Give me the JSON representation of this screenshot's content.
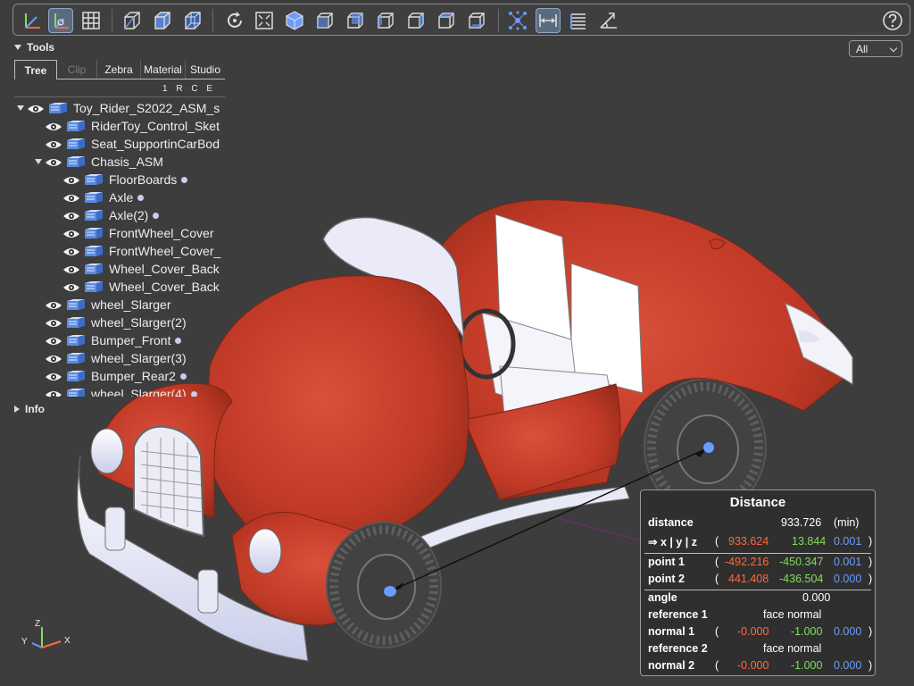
{
  "toolbar": {
    "icons": [
      "axes-icon",
      "origin-axes-icon",
      "grid-icon",
      "box-outline-icon",
      "box-solid-icon",
      "box-wire-icon",
      "rotate-icon",
      "fit-view-icon",
      "iso-view-icon",
      "front-view-icon",
      "back-view-icon",
      "left-view-icon",
      "right-view-icon",
      "top-view-icon",
      "bottom-view-icon",
      "explode-icon",
      "measure-icon",
      "list-icon",
      "angle-icon",
      "help-icon"
    ],
    "active": "measure-icon"
  },
  "tools": {
    "header": "Tools",
    "filter": "All",
    "tabs": [
      {
        "label": "Tree",
        "state": "active"
      },
      {
        "label": "Clip",
        "state": "disabled"
      },
      {
        "label": "Zebra",
        "state": "normal"
      },
      {
        "label": "Material",
        "state": "normal"
      },
      {
        "label": "Studio",
        "state": "normal"
      }
    ],
    "columns": "1 R C E",
    "tree": [
      {
        "label": "Toy_Rider_S2022_ASM_s",
        "level": 0,
        "expander": "open",
        "dot": false
      },
      {
        "label": "RiderToy_Control_Sket",
        "level": 1,
        "expander": "none",
        "dot": false
      },
      {
        "label": "Seat_SupportinCarBod",
        "level": 1,
        "expander": "none",
        "dot": false
      },
      {
        "label": "Chasis_ASM",
        "level": 1,
        "expander": "open",
        "dot": false
      },
      {
        "label": "FloorBoards",
        "level": 2,
        "expander": "none",
        "dot": true
      },
      {
        "label": "Axle",
        "level": 2,
        "expander": "none",
        "dot": true
      },
      {
        "label": "Axle(2)",
        "level": 2,
        "expander": "none",
        "dot": true
      },
      {
        "label": "FrontWheel_Cover",
        "level": 2,
        "expander": "none",
        "dot": false
      },
      {
        "label": "FrontWheel_Cover_",
        "level": 2,
        "expander": "none",
        "dot": false
      },
      {
        "label": "Wheel_Cover_Back",
        "level": 2,
        "expander": "none",
        "dot": false
      },
      {
        "label": "Wheel_Cover_Back",
        "level": 2,
        "expander": "none",
        "dot": false
      },
      {
        "label": "wheel_Slarger",
        "level": 1,
        "expander": "none",
        "dot": false
      },
      {
        "label": "wheel_Slarger(2)",
        "level": 1,
        "expander": "none",
        "dot": false
      },
      {
        "label": "Bumper_Front",
        "level": 1,
        "expander": "none",
        "dot": true
      },
      {
        "label": "wheel_Slarger(3)",
        "level": 1,
        "expander": "none",
        "dot": false
      },
      {
        "label": "Bumper_Rear2",
        "level": 1,
        "expander": "none",
        "dot": true
      },
      {
        "label": "wheel_Slarger(4)",
        "level": 1,
        "expander": "none",
        "dot": true
      }
    ]
  },
  "info": {
    "header": "Info"
  },
  "distance": {
    "title": "Distance",
    "distance_label": "distance",
    "distance_value": "933.726",
    "distance_mode": "(min)",
    "xyz_label": "⇒ x | y | z",
    "dx": "933.624",
    "dy": "13.844",
    "dz": "0.001",
    "point1_label": "point 1",
    "p1x": "-492.216",
    "p1y": "-450.347",
    "p1z": "0.001",
    "point2_label": "point 2",
    "p2x": "441.408",
    "p2y": "-436.504",
    "p2z": "0.000",
    "angle_label": "angle",
    "angle_value": "0.000",
    "ref1_label": "reference 1",
    "ref1_value": "face normal",
    "normal1_label": "normal 1",
    "n1x": "-0.000",
    "n1y": "-1.000",
    "n1z": "0.000",
    "ref2_label": "reference 2",
    "ref2_value": "face normal",
    "normal2_label": "normal 2",
    "n2x": "-0.000",
    "n2y": "-1.000",
    "n2z": "0.000",
    "open_paren": "(",
    "close_paren": ")"
  },
  "triad": {
    "x": "X",
    "y": "Y",
    "z": "Z"
  },
  "colors": {
    "body": "#c53a28",
    "accent": "#6a9cff",
    "x": "#ff6a3d",
    "y": "#7ee05a",
    "z": "#6a9cff"
  }
}
